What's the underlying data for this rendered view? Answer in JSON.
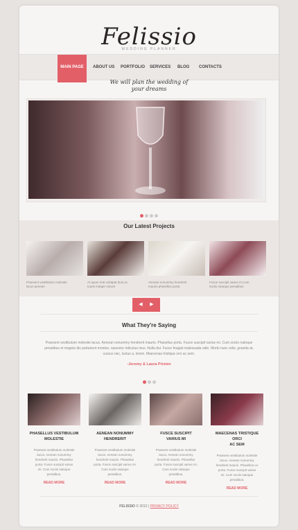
{
  "brand": {
    "logo": "Felissio",
    "tagline": "WEDDING PLANNER"
  },
  "nav": {
    "items": [
      "MAIN PAGE",
      "ABOUT US",
      "PORTFOLIO",
      "SERVICES",
      "BLOG",
      "CONTACTS"
    ]
  },
  "hero": {
    "tagline_line1": "We will plan the wedding of",
    "tagline_line2": "your dreams"
  },
  "projects": {
    "title": "Our Latest Projects",
    "items": [
      {
        "caption_line1": "Praesent vestibulum molestie",
        "caption_line2": "lacus aenean"
      },
      {
        "caption_line1": "Al quam erat volutpat duis ac",
        "caption_line2": "turpis integer rutrum"
      },
      {
        "caption_line1": "Aenean nonummy hendrerit",
        "caption_line2": "mauris phasellus porta"
      },
      {
        "caption_line1": "Fusce suscipit varius mi cum",
        "caption_line2": "sociis natoque penatibus"
      }
    ]
  },
  "testimonials": {
    "title": "What They're Saying",
    "quote": "Praesent vestibulum molestie lacus. Aenean nonummy hendrerit mauris. Phasellus porta. Fusce suscipit varius mi. Cum sociis natoque penatibus et magnis dis parturient montes, nascetur ridiculus mus. Nulla dui. Fusce feugiat malesuada odio. Morbi nunc odio, gravida at, cursus nec, luctus a, lorem. Maecenas tristique orci ac sem.",
    "author": "-Jeremy & Laura Pristen"
  },
  "features": [
    {
      "title_line1": "PHASELLUS VESTIBULUM",
      "title_line2": "MOLESTIE",
      "text_line1": "Praesent vestibulum molestie",
      "text_line2": "lacus. Aenean nonummy",
      "text_line3": "hendrerit mauris. Phasellus",
      "text_line4": "porta. Fusce suscipit varius",
      "text_line5": "mi. Cum sociis natoque",
      "text_line6": "penatibus.",
      "link": "READ MORE"
    },
    {
      "title_line1": "AENEAN NONUMMY",
      "title_line2": "HENDRERIT",
      "text_line1": "Praesent vestibulum molestie",
      "text_line2": "lacus. Aenean nonummy",
      "text_line3": "hendrerit mauris. Phasellus",
      "text_line4": "porta. Fusce suscipit varius mi.",
      "text_line5": "Cum sociis natoque",
      "text_line6": "penatibus.",
      "link": "READ MORE"
    },
    {
      "title_line1": "FUSCE SUSCIPIT",
      "title_line2": "VARIUS MI",
      "text_line1": "Praesent vestibulum molestie",
      "text_line2": "lacus. Aenean nonummy",
      "text_line3": "hendrerit mauris. Phasellus",
      "text_line4": "porta. Fusce suscipit varius mi.",
      "text_line5": "Cum sociis natoque",
      "text_line6": "penatibus.",
      "link": "READ MORE"
    },
    {
      "title_line1": "MAECENAS TRISTIQUE ORCI",
      "title_line2": "AC SEM",
      "text_line1": "Praesent vestibulum molestie",
      "text_line2": "lacus. Aenean nonummy",
      "text_line3": "hendrerit mauris. Phasellus Le",
      "text_line4": "porta. Fusce suscipit varius",
      "text_line5": "mi. Cum sociis natoque",
      "text_line6": "penatibus.",
      "link": "READ MORE"
    }
  ],
  "footer": {
    "brand": "FELISSIO",
    "copy": "© 2012 |",
    "privacy": "PRIVACY POLICY"
  },
  "colors": {
    "accent": "#e25f67",
    "background": "#f7f5f4"
  }
}
